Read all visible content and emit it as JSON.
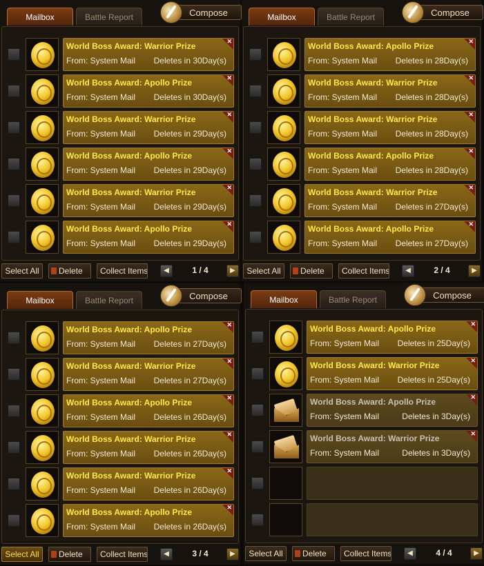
{
  "panels": [
    {
      "tabs": {
        "mailbox": "Mailbox",
        "battle_report": "Battle Report"
      },
      "compose_label": "Compose",
      "rows": [
        {
          "title": "World Boss Award: Warrior Prize",
          "from": "From: System Mail",
          "deletes": "Deletes in 30Day(s)",
          "icon": "gold-coin",
          "state": "unread"
        },
        {
          "title": "World Boss Award: Apollo Prize",
          "from": "From: System Mail",
          "deletes": "Deletes in 30Day(s)",
          "icon": "gold-coin",
          "state": "unread"
        },
        {
          "title": "World Boss Award: Warrior Prize",
          "from": "From: System Mail",
          "deletes": "Deletes in 29Day(s)",
          "icon": "gold-coin",
          "state": "unread"
        },
        {
          "title": "World Boss Award: Apollo Prize",
          "from": "From: System Mail",
          "deletes": "Deletes in 29Day(s)",
          "icon": "gold-coin",
          "state": "unread"
        },
        {
          "title": "World Boss Award: Warrior Prize",
          "from": "From: System Mail",
          "deletes": "Deletes in 29Day(s)",
          "icon": "gold-coin",
          "state": "unread"
        },
        {
          "title": "World Boss Award: Apollo Prize",
          "from": "From: System Mail",
          "deletes": "Deletes in 29Day(s)",
          "icon": "gold-coin",
          "state": "unread"
        }
      ],
      "select_all": "Select All",
      "select_all_active": false,
      "delete": "Delete",
      "collect": "Collect Items",
      "page": "1 / 4"
    },
    {
      "tabs": {
        "mailbox": "Mailbox",
        "battle_report": "Battle Report"
      },
      "compose_label": "Compose",
      "rows": [
        {
          "title": "World Boss Award: Apollo Prize",
          "from": "From: System Mail",
          "deletes": "Deletes in 28Day(s)",
          "icon": "gold-coin",
          "state": "unread"
        },
        {
          "title": "World Boss Award: Warrior Prize",
          "from": "From: System Mail",
          "deletes": "Deletes in 28Day(s)",
          "icon": "gold-coin",
          "state": "unread"
        },
        {
          "title": "World Boss Award: Warrior Prize",
          "from": "From: System Mail",
          "deletes": "Deletes in 28Day(s)",
          "icon": "gold-coin",
          "state": "unread"
        },
        {
          "title": "World Boss Award: Apollo Prize",
          "from": "From: System Mail",
          "deletes": "Deletes in 28Day(s)",
          "icon": "gold-coin",
          "state": "unread"
        },
        {
          "title": "World Boss Award: Warrior Prize",
          "from": "From: System Mail",
          "deletes": "Deletes in 27Day(s)",
          "icon": "gold-coin",
          "state": "unread"
        },
        {
          "title": "World Boss Award: Apollo Prize",
          "from": "From: System Mail",
          "deletes": "Deletes in 27Day(s)",
          "icon": "gold-coin",
          "state": "unread"
        }
      ],
      "select_all": "Select All",
      "select_all_active": false,
      "delete": "Delete",
      "collect": "Collect Items",
      "page": "2 / 4"
    },
    {
      "tabs": {
        "mailbox": "Mailbox",
        "battle_report": "Battle Report"
      },
      "compose_label": "Compose",
      "rows": [
        {
          "title": "World Boss Award: Apollo Prize",
          "from": "From: System Mail",
          "deletes": "Deletes in 27Day(s)",
          "icon": "gold-coin",
          "state": "unread"
        },
        {
          "title": "World Boss Award: Warrior Prize",
          "from": "From: System Mail",
          "deletes": "Deletes in 27Day(s)",
          "icon": "gold-coin",
          "state": "unread"
        },
        {
          "title": "World Boss Award: Apollo Prize",
          "from": "From: System Mail",
          "deletes": "Deletes in 26Day(s)",
          "icon": "gold-coin",
          "state": "unread"
        },
        {
          "title": "World Boss Award: Warrior Prize",
          "from": "From: System Mail",
          "deletes": "Deletes in 26Day(s)",
          "icon": "gold-coin",
          "state": "unread"
        },
        {
          "title": "World Boss Award: Warrior Prize",
          "from": "From: System Mail",
          "deletes": "Deletes in 26Day(s)",
          "icon": "gold-coin",
          "state": "unread"
        },
        {
          "title": "World Boss Award: Apollo Prize",
          "from": "From: System Mail",
          "deletes": "Deletes in 26Day(s)",
          "icon": "gold-coin",
          "state": "unread"
        }
      ],
      "select_all": "Select All",
      "select_all_active": true,
      "delete": "Delete",
      "collect": "Collect Items",
      "page": "3 / 4"
    },
    {
      "tabs": {
        "mailbox": "Mailbox",
        "battle_report": "Battle Report"
      },
      "compose_label": "Compose",
      "rows": [
        {
          "title": "World Boss Award: Apollo Prize",
          "from": "From: System Mail",
          "deletes": "Deletes in 25Day(s)",
          "icon": "gold-coin",
          "state": "unread"
        },
        {
          "title": "World Boss Award: Warrior Prize",
          "from": "From: System Mail",
          "deletes": "Deletes in 25Day(s)",
          "icon": "gold-coin",
          "state": "unread"
        },
        {
          "title": "World Boss Award: Apollo Prize",
          "from": "From: System Mail",
          "deletes": "Deletes in 3Day(s)",
          "icon": "scroll-envelope",
          "state": "read"
        },
        {
          "title": "World Boss Award: Warrior Prize",
          "from": "From: System Mail",
          "deletes": "Deletes in 3Day(s)",
          "icon": "scroll-envelope",
          "state": "read"
        },
        {
          "title": "",
          "from": "",
          "deletes": "",
          "icon": "none",
          "state": "empty"
        },
        {
          "title": "",
          "from": "",
          "deletes": "",
          "icon": "none",
          "state": "empty"
        }
      ],
      "select_all": "Select All",
      "select_all_active": false,
      "delete": "Delete",
      "collect": "Collect Items",
      "page": "4 / 4"
    }
  ],
  "colors": {
    "title_unread": "#ffe84a",
    "title_read": "#c8c2b4",
    "card_gold": "#8a6818",
    "tab_active": "#7a3c14"
  }
}
